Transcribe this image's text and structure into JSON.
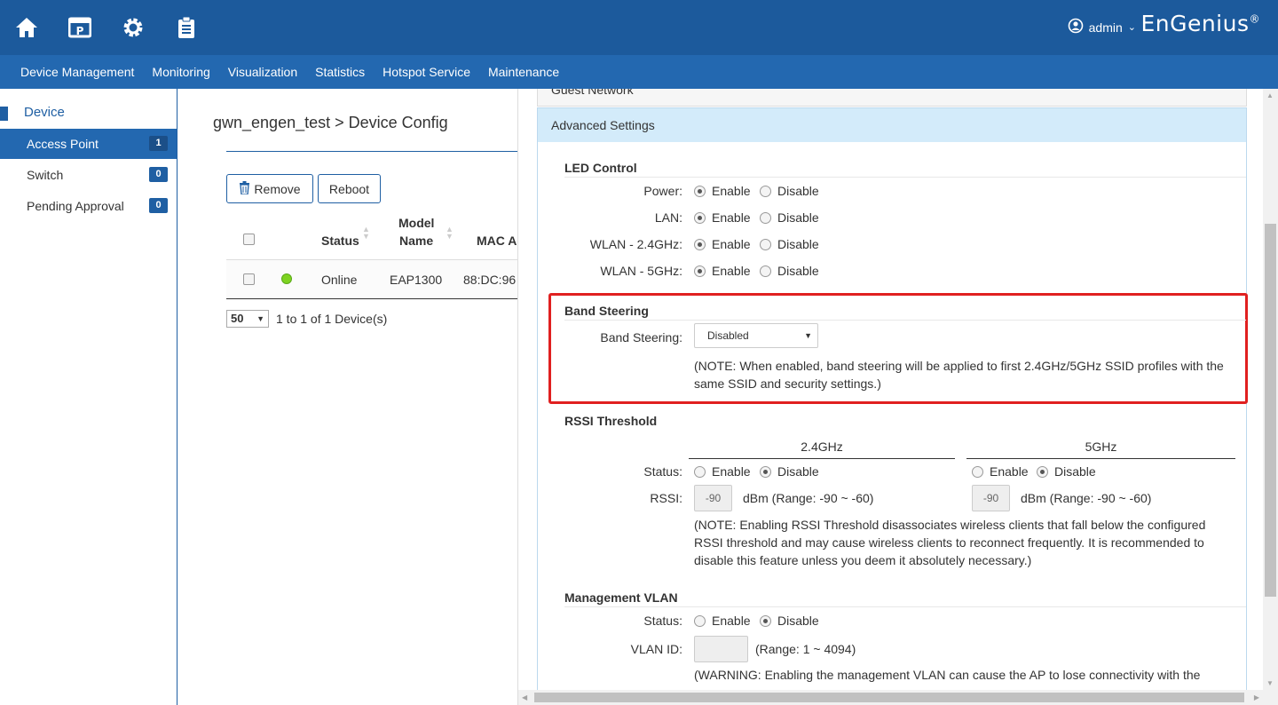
{
  "header": {
    "user": "admin",
    "brand": "EnGenius",
    "brand_mark": "®"
  },
  "nav": [
    "Device Management",
    "Monitoring",
    "Visualization",
    "Statistics",
    "Hotspot Service",
    "Maintenance"
  ],
  "sidebar": {
    "heading": "Device",
    "items": [
      {
        "label": "Access Point",
        "count": "1"
      },
      {
        "label": "Switch",
        "count": "0"
      },
      {
        "label": "Pending Approval",
        "count": "0"
      }
    ]
  },
  "middle": {
    "breadcrumb": "gwn_engen_test > Device Config",
    "remove_label": "Remove",
    "reboot_label": "Reboot",
    "columns": {
      "status": "Status",
      "model_1": "Model",
      "model_2": "Name",
      "mac": "MAC A"
    },
    "row": {
      "status": "Online",
      "model": "EAP1300",
      "mac": "88:DC:96"
    },
    "page_size": "50",
    "page_info": "1 to 1 of 1 Device(s)"
  },
  "config": {
    "guest_network": "Guest Network",
    "advanced_settings": "Advanced Settings",
    "led": {
      "title": "LED Control",
      "rows": [
        {
          "label": "Power:",
          "enable": "Enable",
          "disable": "Disable"
        },
        {
          "label": "LAN:",
          "enable": "Enable",
          "disable": "Disable"
        },
        {
          "label": "WLAN - 2.4GHz:",
          "enable": "Enable",
          "disable": "Disable"
        },
        {
          "label": "WLAN - 5GHz:",
          "enable": "Enable",
          "disable": "Disable"
        }
      ]
    },
    "band_steering": {
      "title": "Band Steering",
      "label": "Band Steering:",
      "value": "Disabled",
      "note_1": "(NOTE: When enabled, band steering will be applied to first 2.4GHz/5GHz SSID profiles with the",
      "note_2": "same SSID and security settings.)"
    },
    "rssi": {
      "title": "RSSI Threshold",
      "band_24": "2.4GHz",
      "band_5": "5GHz",
      "status_label": "Status:",
      "rssi_label": "RSSI:",
      "enable": "Enable",
      "disable": "Disable",
      "value_24": "-90",
      "value_5": "-90",
      "range_24": "dBm (Range: -90 ~ -60)",
      "range_5": "dBm (Range: -90 ~ -60)",
      "note_1": "(NOTE: Enabling RSSI Threshold disassociates wireless clients that fall below the configured",
      "note_2": "RSSI threshold and may cause wireless clients to reconnect frequently. It is recommended to",
      "note_3": "disable this feature unless you deem it absolutely necessary.)"
    },
    "mgmt_vlan": {
      "title": "Management VLAN",
      "status_label": "Status:",
      "enable": "Enable",
      "disable": "Disable",
      "vlan_label": "VLAN ID:",
      "vlan_value": "",
      "range": "(Range: 1 ~ 4094)",
      "warning": "(WARNING: Enabling the management VLAN can cause the AP to lose connectivity with the"
    }
  },
  "colors": {
    "header": "#1c5a9c",
    "nav": "#2368b0",
    "highlight": "#e02020",
    "panel_head": "#d3ebfa",
    "online": "#7ed321"
  }
}
